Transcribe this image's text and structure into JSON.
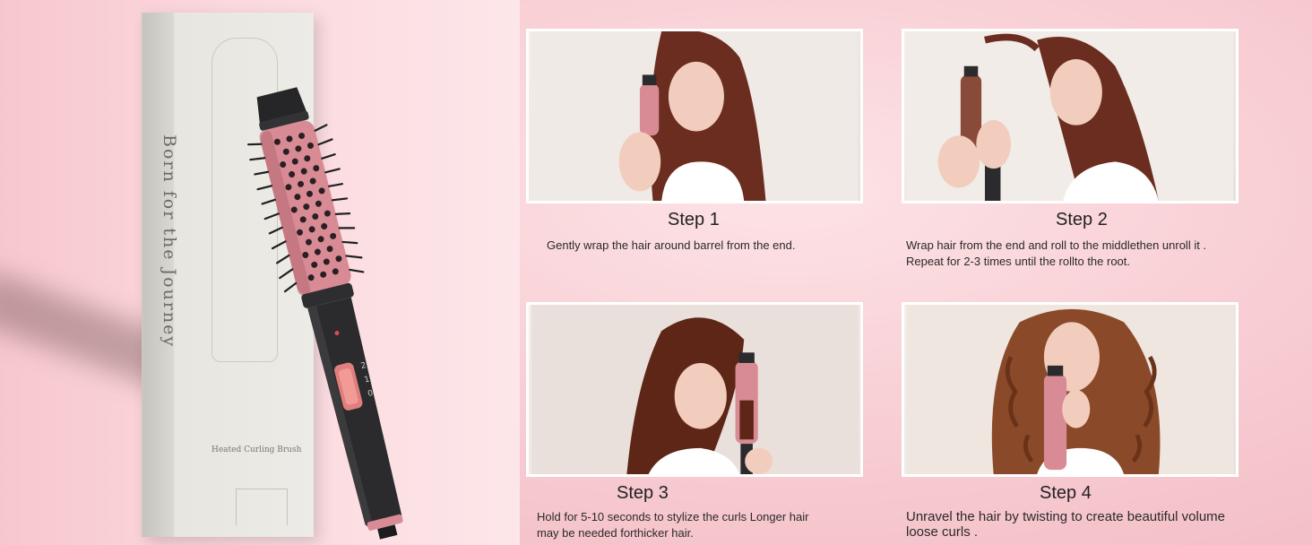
{
  "product": {
    "box_slogan": "Born for the Journey",
    "box_caption": "Heated Curling Brush",
    "switch_labels": [
      "2",
      "1",
      "0"
    ],
    "colors": {
      "barrel": "#d98b95",
      "handle": "#2b2b2d",
      "accent": "#e07f7d",
      "box": "#e7e6e0"
    }
  },
  "steps": [
    {
      "title": "Step 1",
      "description": "Gently wrap the hair around  barrel  from the end.",
      "photo_icon": "woman-straight-hair-brush"
    },
    {
      "title": "Step 2",
      "description": "Wrap hair from the end and roll to the middlethen unroll it . Repeat for  2-3 times until the rollto the root.",
      "photo_icon": "woman-profile-rolling-hair"
    },
    {
      "title": "Step 3",
      "description": "Hold for 5-10 seconds to stylize the curls Longer hair may be needed forthicker hair.",
      "photo_icon": "woman-holding-brush-side"
    },
    {
      "title": "Step 4",
      "description": "Unravel the hair by twisting to  create beautiful volume loose curls .",
      "photo_icon": "woman-curly-hair-smiling"
    }
  ]
}
